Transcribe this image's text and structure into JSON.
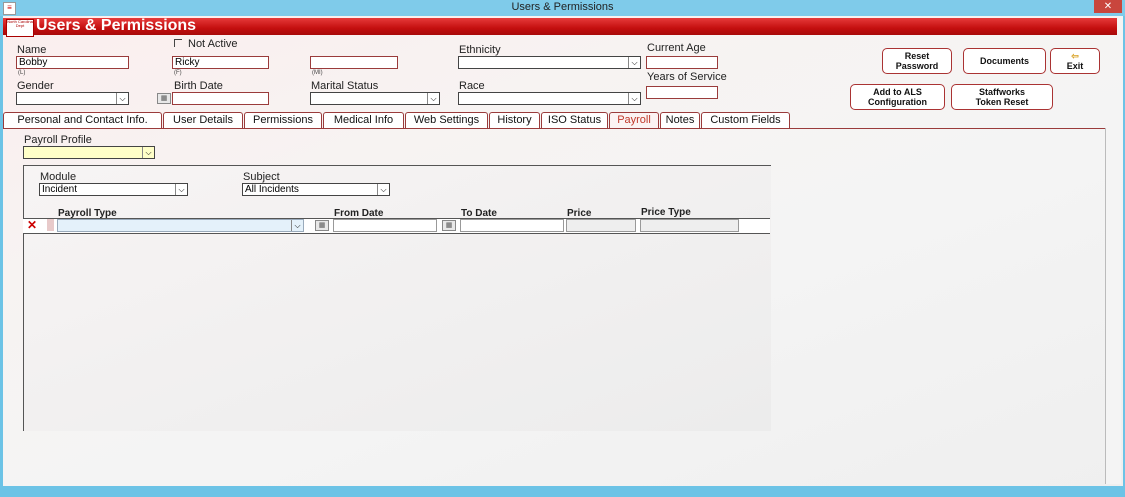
{
  "window": {
    "title": "Users & Permissions",
    "close": "✕"
  },
  "header": {
    "title": "Users & Permissions",
    "logo_text": "North Carolina Dept"
  },
  "form": {
    "name_label": "Name",
    "last_name": "Bobby",
    "last_sub": "(L)",
    "first_name": "Ricky",
    "first_sub": "(F)",
    "middle_name": "",
    "middle_sub": "(MI)",
    "not_active_label": "Not Active",
    "ethnicity_label": "Ethnicity",
    "ethnicity_value": "",
    "current_age_label": "Current Age",
    "current_age_value": "",
    "years_service_label": "Years of Service",
    "years_service_value": "",
    "gender_label": "Gender",
    "gender_value": "",
    "birth_date_label": "Birth Date",
    "birth_date_value": "",
    "marital_label": "Marital Status",
    "marital_value": "",
    "race_label": "Race",
    "race_value": ""
  },
  "buttons": {
    "reset_password": "Reset Password",
    "documents": "Documents",
    "exit": "Exit",
    "add_als": "Add to ALS Configuration",
    "staffworks": "Staffworks Token Reset"
  },
  "tabs": [
    "Personal and Contact Info.",
    "User Details",
    "Permissions",
    "Medical Info",
    "Web Settings",
    "History",
    "ISO Status",
    "Payroll",
    "Notes",
    "Custom Fields"
  ],
  "active_tab": "Payroll",
  "payroll": {
    "profile_label": "Payroll Profile",
    "profile_value": "",
    "module_label": "Module",
    "module_value": "Incident",
    "subject_label": "Subject",
    "subject_value": "All Incidents",
    "columns": [
      "Payroll Type",
      "From Date",
      "To Date",
      "Price",
      "Price Type"
    ],
    "delete_icon": "✕"
  }
}
